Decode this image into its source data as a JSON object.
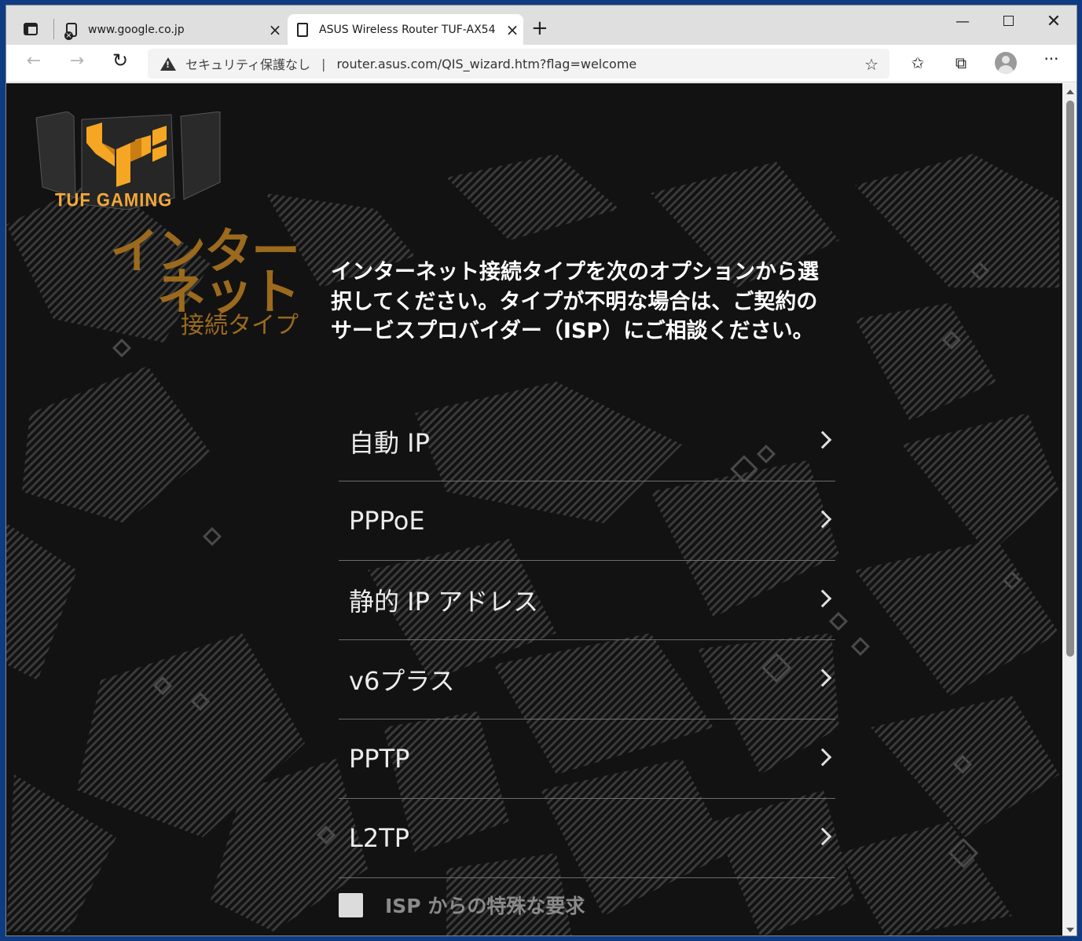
{
  "browser": {
    "tabs": [
      {
        "title": "www.google.co.jp",
        "active": false
      },
      {
        "title": "ASUS Wireless Router TUF-AX54",
        "active": true
      }
    ],
    "security_label": "セキュリティ保護なし",
    "url": "router.asus.com/QIS_wizard.htm?flag=welcome",
    "separator": "|"
  },
  "logo": {
    "text": "TUF GAMING"
  },
  "heading": {
    "line1": "インター",
    "line2": "ネット",
    "sub": "接続タイプ"
  },
  "description": "インターネット接続タイプを次のオプションから選択してください。タイプが不明な場合は、ご契約のサービスプロバイダー（ISP）にご相談ください。",
  "options": [
    {
      "label": "自動 IP"
    },
    {
      "label": "PPPoE"
    },
    {
      "label": "静的 IP アドレス"
    },
    {
      "label": "v6プラス"
    },
    {
      "label": "PPTP"
    },
    {
      "label": "L2TP"
    }
  ],
  "isp_special": {
    "label": "ISP からの特殊な要求",
    "checked": false
  },
  "colors": {
    "accent": "#9b6a1d",
    "logo_orange": "#f3a83a",
    "background": "#121212"
  }
}
